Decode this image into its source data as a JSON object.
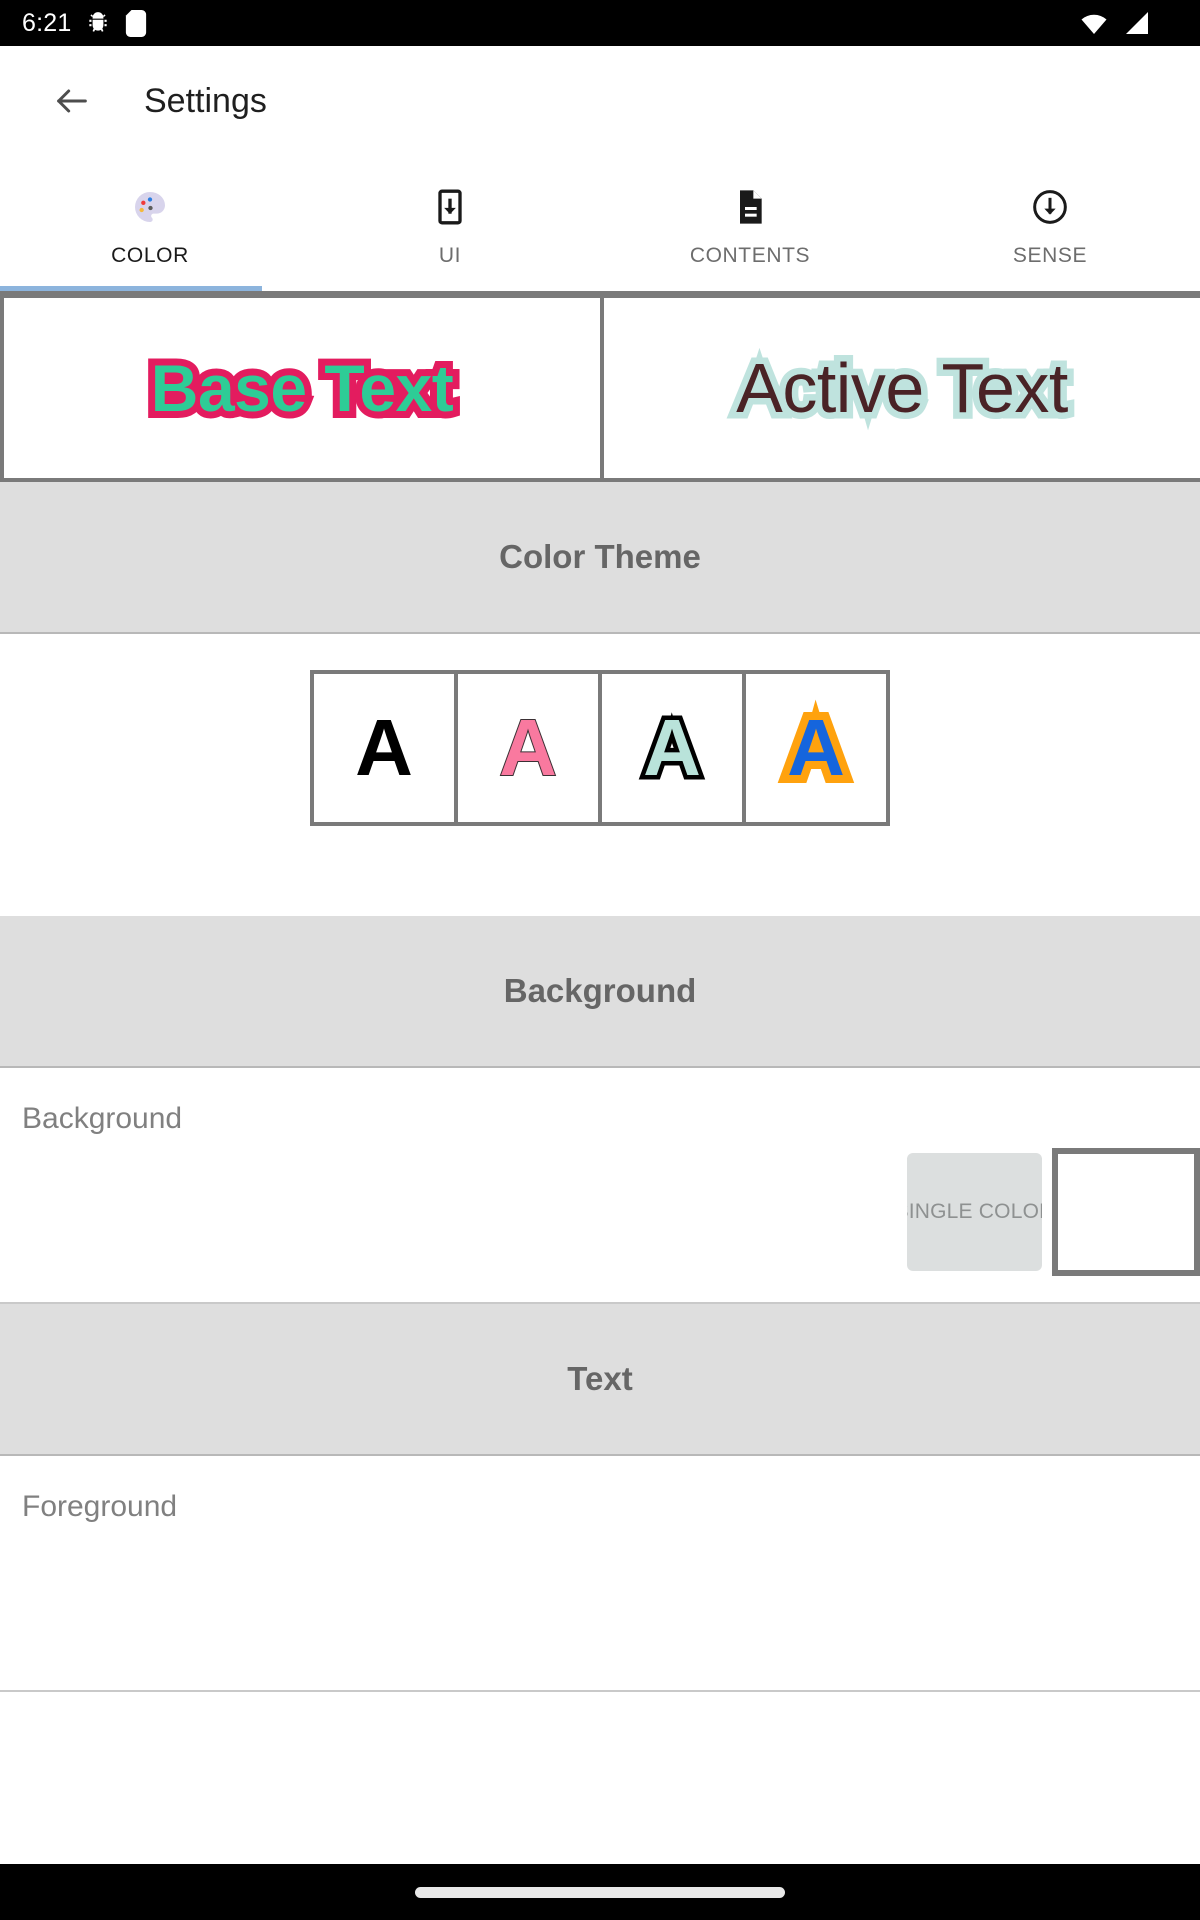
{
  "statusbar": {
    "time": "6:21",
    "icons_left": [
      "android-bug-icon",
      "sd-card-icon"
    ],
    "icons_right": [
      "wifi-icon",
      "signal-icon"
    ]
  },
  "appbar": {
    "back_icon": "back-arrow-icon",
    "title": "Settings"
  },
  "tabs": {
    "selected_index": 0,
    "indicator_color": "#8cb4dd",
    "items": [
      {
        "label": "COLOR",
        "icon": "palette-icon"
      },
      {
        "label": "UI",
        "icon": "phone-download-icon"
      },
      {
        "label": "CONTENTS",
        "icon": "document-icon"
      },
      {
        "label": "SENSE",
        "icon": "circle-down-arrow-icon"
      }
    ]
  },
  "preview": {
    "base": {
      "text": "Base Text",
      "fill_color": "#2ecc96",
      "outline_color": "#e31c5f"
    },
    "active": {
      "text": "Active Text",
      "fill_color": "#4a2326",
      "outline_color": "#bfe3de"
    }
  },
  "sections": {
    "color_theme": {
      "title": "Color Theme",
      "themes": [
        {
          "letter": "A",
          "fill": "#000000",
          "stroke": "#000000",
          "stroke_width": "0px",
          "name": "theme-black"
        },
        {
          "letter": "A",
          "fill": "#f9799f",
          "stroke": "#3b3034",
          "stroke_width": "2px",
          "name": "theme-pink"
        },
        {
          "letter": "A",
          "fill": "#b9e3da",
          "stroke": "#000000",
          "stroke_width": "9px",
          "name": "theme-mint"
        },
        {
          "letter": "A",
          "fill": "#1565dd",
          "stroke": "#ffa20e",
          "stroke_width": "16px",
          "name": "theme-blue-orange"
        }
      ]
    },
    "background": {
      "title": "Background",
      "row_label": "Background",
      "single_color_button": "SINGLE COLOR",
      "swatch_color": "#ffffff"
    },
    "text": {
      "title": "Text",
      "row_label": "Foreground"
    }
  }
}
